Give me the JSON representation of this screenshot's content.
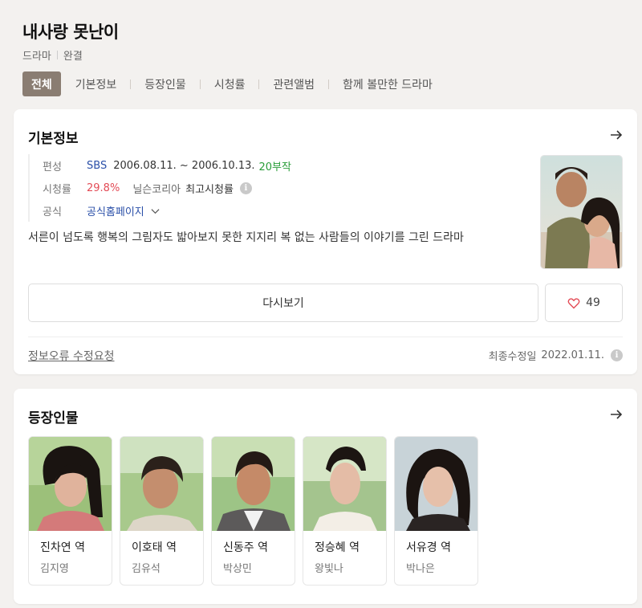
{
  "header": {
    "title": "내사랑 못난이",
    "genre": "드라마",
    "status": "완결"
  },
  "tabs": [
    {
      "label": "전체",
      "active": true
    },
    {
      "label": "기본정보",
      "active": false
    },
    {
      "label": "등장인물",
      "active": false
    },
    {
      "label": "시청률",
      "active": false
    },
    {
      "label": "관련앨범",
      "active": false
    },
    {
      "label": "함께 볼만한 드라마",
      "active": false
    }
  ],
  "basic_info": {
    "heading": "기본정보",
    "broadcast_label": "편성",
    "channel": "SBS",
    "period": "2006.08.11. ~ 2006.10.13.",
    "episodes": "20부작",
    "rating_label": "시청률",
    "rating_value": "29.8%",
    "rating_source": "닐슨코리아",
    "rating_type": "최고시청률",
    "official_label": "공식",
    "official_link": "공식홈페이지",
    "description": "서른이 넘도록 행복의 그림자도 밟아보지 못한 지지리 복 없는 사람들의 이야기를 그린 드라마",
    "replay_label": "다시보기",
    "like_count": "49",
    "report_label": "정보오류 수정요청",
    "updated_label": "최종수정일",
    "updated_date": "2022.01.11."
  },
  "cast": {
    "heading": "등장인물",
    "members": [
      {
        "role": "진차연 역",
        "actor": "김지영"
      },
      {
        "role": "이호태 역",
        "actor": "김유석"
      },
      {
        "role": "신동주 역",
        "actor": "박상민"
      },
      {
        "role": "정승혜 역",
        "actor": "왕빛나"
      },
      {
        "role": "서유경 역",
        "actor": "박나은"
      }
    ]
  },
  "colors": {
    "active_tab": "#8a7d72",
    "link_blue": "#2a4fa8",
    "episodes_green": "#2a9d3a",
    "rating_red": "#e34b56",
    "heart": "#e34b56"
  }
}
